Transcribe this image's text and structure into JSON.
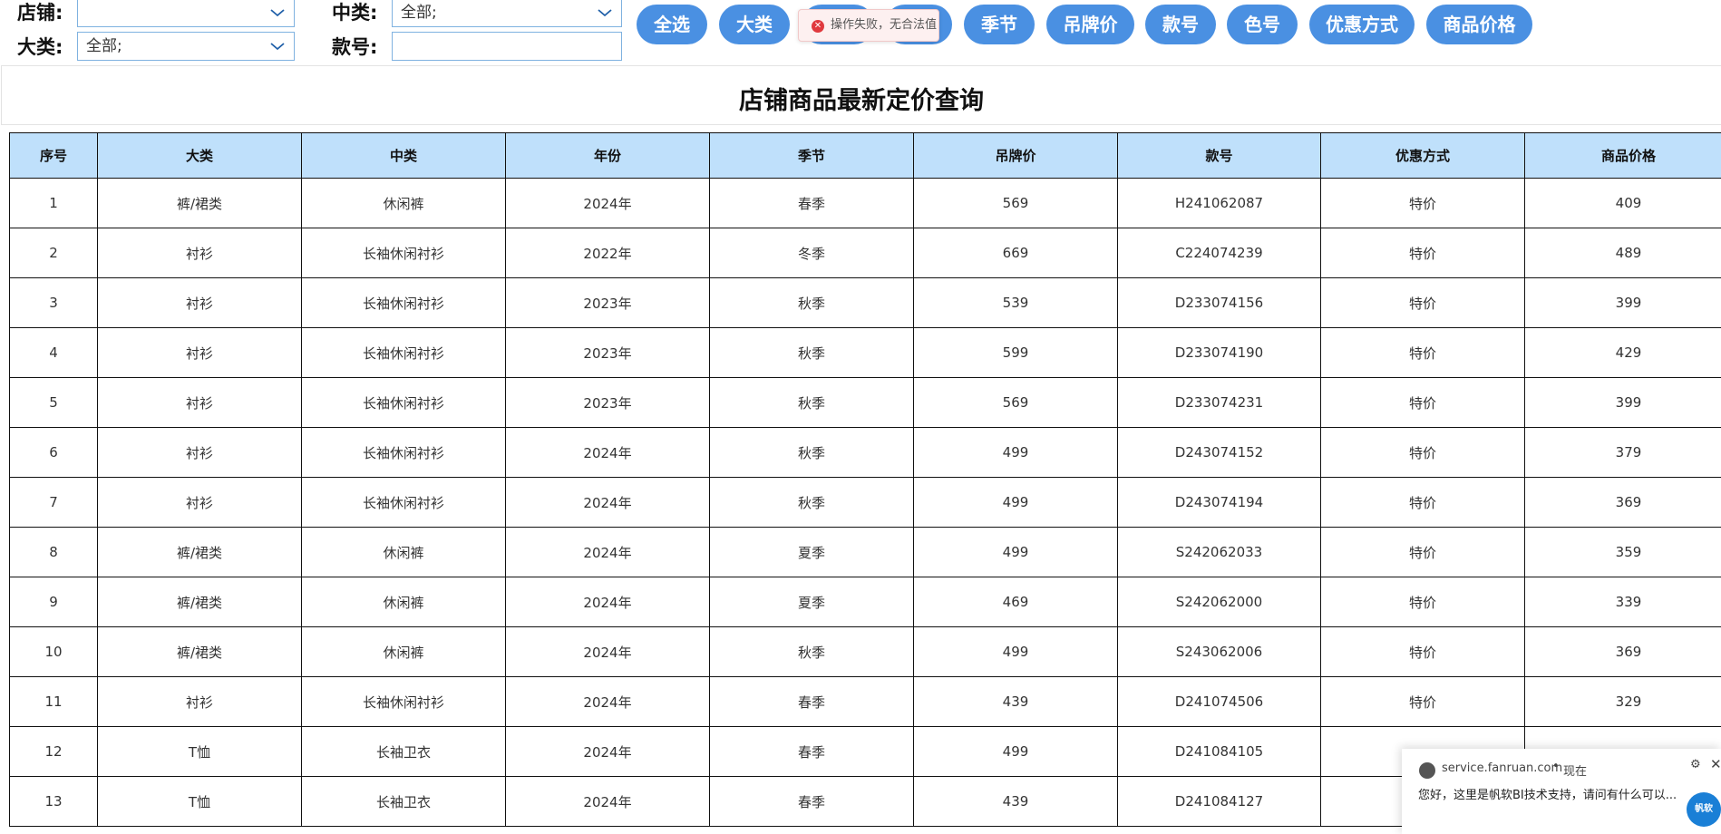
{
  "filters": {
    "store_label": "店铺:",
    "store_value": "",
    "category_label": "大类:",
    "category_value": "全部;",
    "midcategory_label": "中类:",
    "midcategory_value": "全部;",
    "style_label": "款号:",
    "style_value": ""
  },
  "buttons": [
    "全选",
    "大类",
    "",
    "",
    "季节",
    "吊牌价",
    "款号",
    "色号",
    "优惠方式",
    "商品价格"
  ],
  "toast": {
    "message": "操作失败，无合法值",
    "icon": "error-icon"
  },
  "title": "店铺商品最新定价查询",
  "table": {
    "headers": [
      "序号",
      "大类",
      "中类",
      "年份",
      "季节",
      "吊牌价",
      "款号",
      "优惠方式",
      "商品价格"
    ],
    "rows": [
      [
        "1",
        "裤/裙类",
        "休闲裤",
        "2024年",
        "春季",
        "569",
        "H241062087",
        "特价",
        "409"
      ],
      [
        "2",
        "衬衫",
        "长袖休闲衬衫",
        "2022年",
        "冬季",
        "669",
        "C224074239",
        "特价",
        "489"
      ],
      [
        "3",
        "衬衫",
        "长袖休闲衬衫",
        "2023年",
        "秋季",
        "539",
        "D233074156",
        "特价",
        "399"
      ],
      [
        "4",
        "衬衫",
        "长袖休闲衬衫",
        "2023年",
        "秋季",
        "599",
        "D233074190",
        "特价",
        "429"
      ],
      [
        "5",
        "衬衫",
        "长袖休闲衬衫",
        "2023年",
        "秋季",
        "569",
        "D233074231",
        "特价",
        "399"
      ],
      [
        "6",
        "衬衫",
        "长袖休闲衬衫",
        "2024年",
        "秋季",
        "499",
        "D243074152",
        "特价",
        "379"
      ],
      [
        "7",
        "衬衫",
        "长袖休闲衬衫",
        "2024年",
        "秋季",
        "499",
        "D243074194",
        "特价",
        "369"
      ],
      [
        "8",
        "裤/裙类",
        "休闲裤",
        "2024年",
        "夏季",
        "499",
        "S242062033",
        "特价",
        "359"
      ],
      [
        "9",
        "裤/裙类",
        "休闲裤",
        "2024年",
        "夏季",
        "469",
        "S242062000",
        "特价",
        "339"
      ],
      [
        "10",
        "裤/裙类",
        "休闲裤",
        "2024年",
        "秋季",
        "499",
        "S243062006",
        "特价",
        "369"
      ],
      [
        "11",
        "衬衫",
        "长袖休闲衬衫",
        "2024年",
        "春季",
        "439",
        "D241074506",
        "特价",
        "329"
      ],
      [
        "12",
        "T恤",
        "长袖卫衣",
        "2024年",
        "春季",
        "499",
        "D241084105",
        "",
        ""
      ],
      [
        "13",
        "T恤",
        "长袖卫衣",
        "2024年",
        "春季",
        "439",
        "D241084127",
        "",
        ""
      ]
    ]
  },
  "chat": {
    "origin": "service.fanruan.com",
    "separator": "•",
    "time": "现在",
    "message": "您好，这里是帆软BI技术支持，请问有什么可以...",
    "badge": "帆软"
  },
  "colors": {
    "button_bg": "#4a90e2",
    "header_bg": "#bfe0fb",
    "input_border": "#7fb2e0",
    "error_red": "#e0393e"
  }
}
